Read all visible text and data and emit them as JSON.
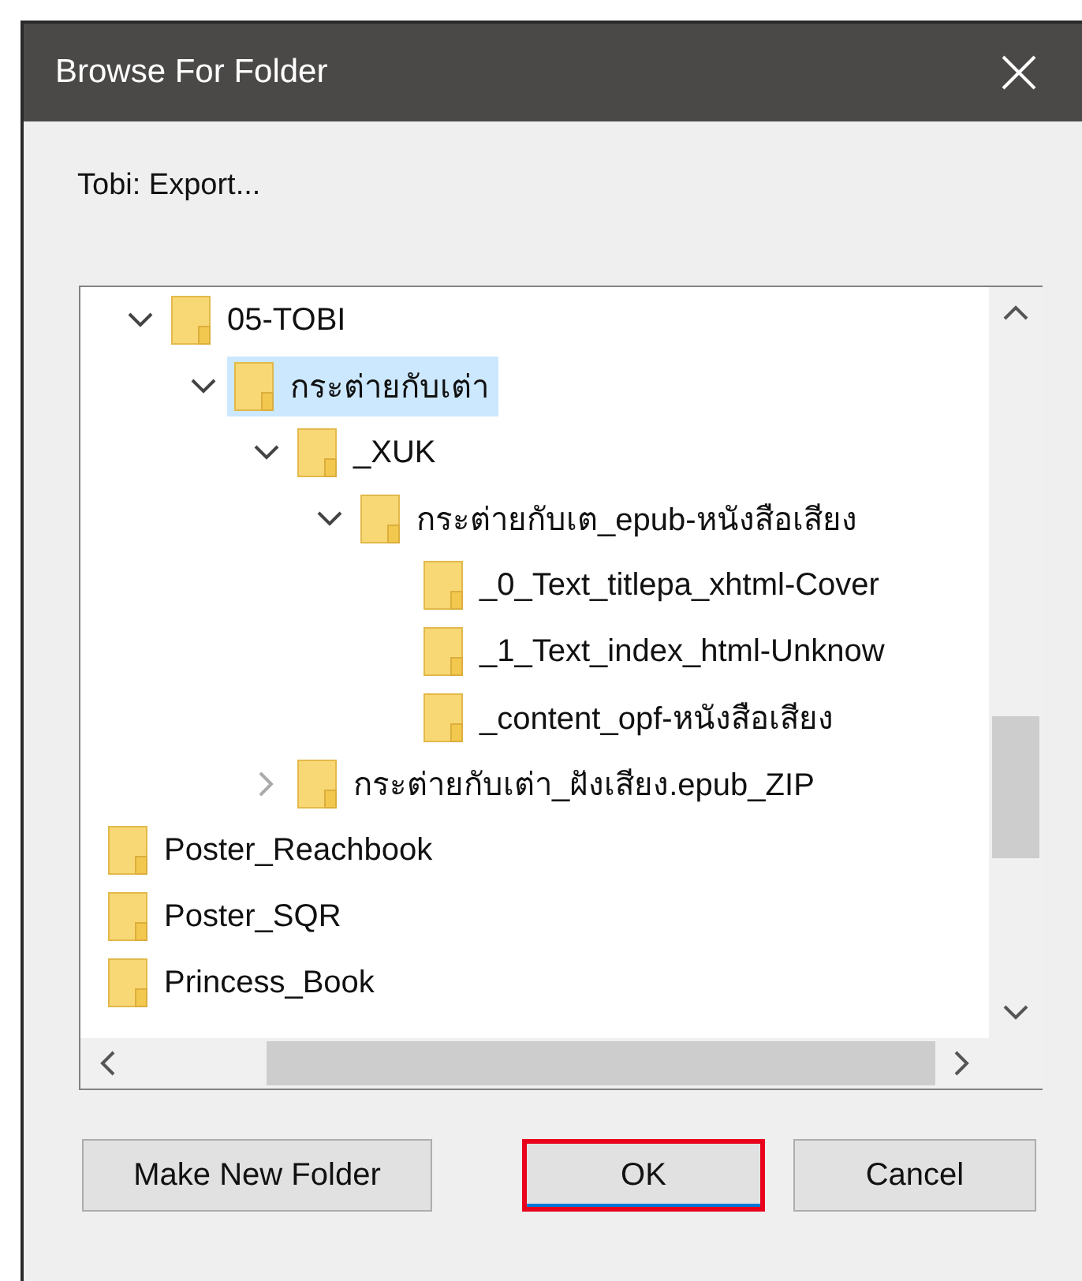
{
  "window": {
    "title": "Browse For Folder"
  },
  "description": "Tobi: Export...",
  "tree": {
    "nested_items": [
      {
        "label": "05-TOBI",
        "expanded": true,
        "selected": false,
        "children": [
          {
            "label": "กระต่ายกับเต่า",
            "expanded": true,
            "selected": true,
            "children": [
              {
                "label": "_XUK",
                "expanded": true,
                "selected": false,
                "children": [
                  {
                    "label": "กระต่ายกับเต_epub-หนังสือเสียง",
                    "expanded": true,
                    "selected": false,
                    "children": [
                      {
                        "label": "_0_Text_titlepa_xhtml-Cover",
                        "selected": false
                      },
                      {
                        "label": "_1_Text_index_html-Unknow",
                        "selected": false
                      },
                      {
                        "label": "_content_opf-หนังสือเสียง",
                        "selected": false
                      }
                    ]
                  }
                ]
              },
              {
                "label": "กระต่ายกับเต่า_ฝังเสียง.epub_ZIP",
                "expanded": false,
                "selected": false
              }
            ]
          }
        ]
      }
    ],
    "items": [
      {
        "label": "Poster_Reachbook",
        "selected": false
      },
      {
        "label": "Poster_SQR",
        "selected": false
      },
      {
        "label": "Princess_Book",
        "selected": false
      }
    ]
  },
  "buttons": [
    {
      "label": "Make New Folder",
      "focused": false
    },
    {
      "label": "OK",
      "focused": true
    },
    {
      "label": "Cancel",
      "focused": false
    }
  ]
}
